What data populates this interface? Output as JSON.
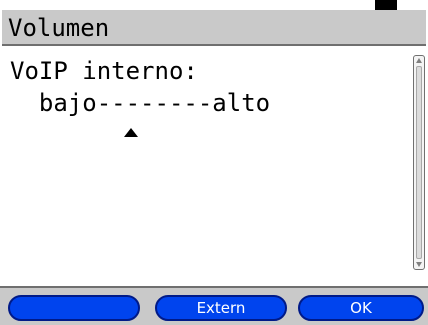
{
  "title": "Volumen",
  "content": {
    "heading": "VoIP interno:",
    "scale_text": "  bajo--------alto",
    "level": 0.25
  },
  "softkeys": {
    "key1_label": "",
    "key2_label": "Extern",
    "key3_label": "OK"
  },
  "colors": {
    "titlebar": "#c9c9c9",
    "softkey": "#0044ee",
    "softkey_text": "#ffffff"
  }
}
